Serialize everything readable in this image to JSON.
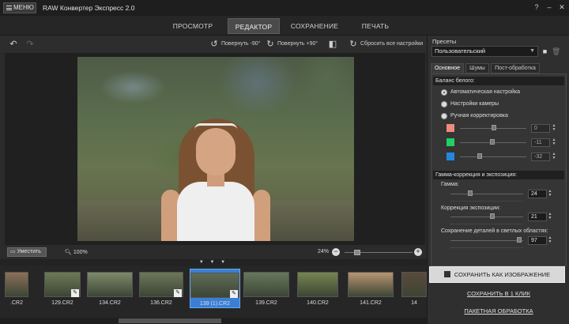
{
  "titlebar": {
    "menu_label": "МЕНЮ",
    "app_title": "RAW Конвертер Экспресс 2.0",
    "controls": [
      "?",
      "–",
      "✕"
    ]
  },
  "top_tabs": [
    {
      "label": "ПРОСМОТР",
      "active": false
    },
    {
      "label": "РЕДАКТОР",
      "active": true
    },
    {
      "label": "СОХРАНЕНИЕ",
      "active": false
    },
    {
      "label": "ПЕЧАТЬ",
      "active": false
    }
  ],
  "toolbar": {
    "undo_icon": "undo-icon",
    "redo_icon": "redo-icon",
    "rotate_left_label": "Повернуть -90°",
    "rotate_right_label": "Повернуть +90°",
    "reset_label": "Сбросить все настройки"
  },
  "zoombar": {
    "fit_label": "Уместить",
    "left_zoom": "100%",
    "right_zoom": "24%",
    "zoom_level": 0.15
  },
  "filmstrip": {
    "handle": "▼ ▼ ▼",
    "items": [
      {
        "caption": ".CR2",
        "edited": false,
        "selected": false,
        "tone": "#8a7058"
      },
      {
        "caption": "129.CR2",
        "edited": true,
        "selected": false,
        "tone": "#6b7a55"
      },
      {
        "caption": "134.CR2",
        "edited": false,
        "selected": false,
        "tone": "#7d8a6a"
      },
      {
        "caption": "136.CR2",
        "edited": true,
        "selected": false,
        "tone": "#6d7758"
      },
      {
        "caption": "139 (1).CR2",
        "edited": true,
        "selected": true,
        "tone": "#5e6c55"
      },
      {
        "caption": "139.CR2",
        "edited": false,
        "selected": false,
        "tone": "#66785c"
      },
      {
        "caption": "140.CR2",
        "edited": false,
        "selected": false,
        "tone": "#75864f"
      },
      {
        "caption": "141.CR2",
        "edited": false,
        "selected": false,
        "tone": "#b89570"
      },
      {
        "caption": "14",
        "edited": false,
        "selected": false,
        "tone": "#5a4a3a"
      }
    ]
  },
  "right_panel": {
    "presets_label": "Пресеты",
    "preset_value": "Пользовательский",
    "subtabs": [
      {
        "label": "Основное",
        "active": true
      },
      {
        "label": "Шумы",
        "active": false
      },
      {
        "label": "Пост-обработка",
        "active": false
      }
    ],
    "white_balance": {
      "header": "Баланс белого:",
      "options": [
        {
          "label": "Автоматическая настройка",
          "checked": true
        },
        {
          "label": "Настройки камеры",
          "checked": false
        },
        {
          "label": "Ручная корректировка",
          "checked": false
        }
      ],
      "channels": [
        {
          "color": "#f08a80",
          "value": "0"
        },
        {
          "color": "#20d060",
          "value": "-11"
        },
        {
          "color": "#2288dd",
          "value": "-32"
        }
      ]
    },
    "gamma": {
      "header": "Гамма-коррекция и экспозиция:",
      "gamma_label": "Гамма:",
      "gamma_value": "24",
      "exposure_label": "Коррекция экспозиции:",
      "exposure_value": "21",
      "highlights_label": "Сохранение деталей в светлых областях:",
      "highlights_value": "97"
    },
    "save_image_label": "СОХРАНИТЬ КАК ИЗОБРАЖЕНИЕ",
    "save_one_click_label": "СОХРАНИТЬ В 1 КЛИК",
    "batch_label": "ПАКЕТНАЯ ОБРАБОТКА"
  }
}
